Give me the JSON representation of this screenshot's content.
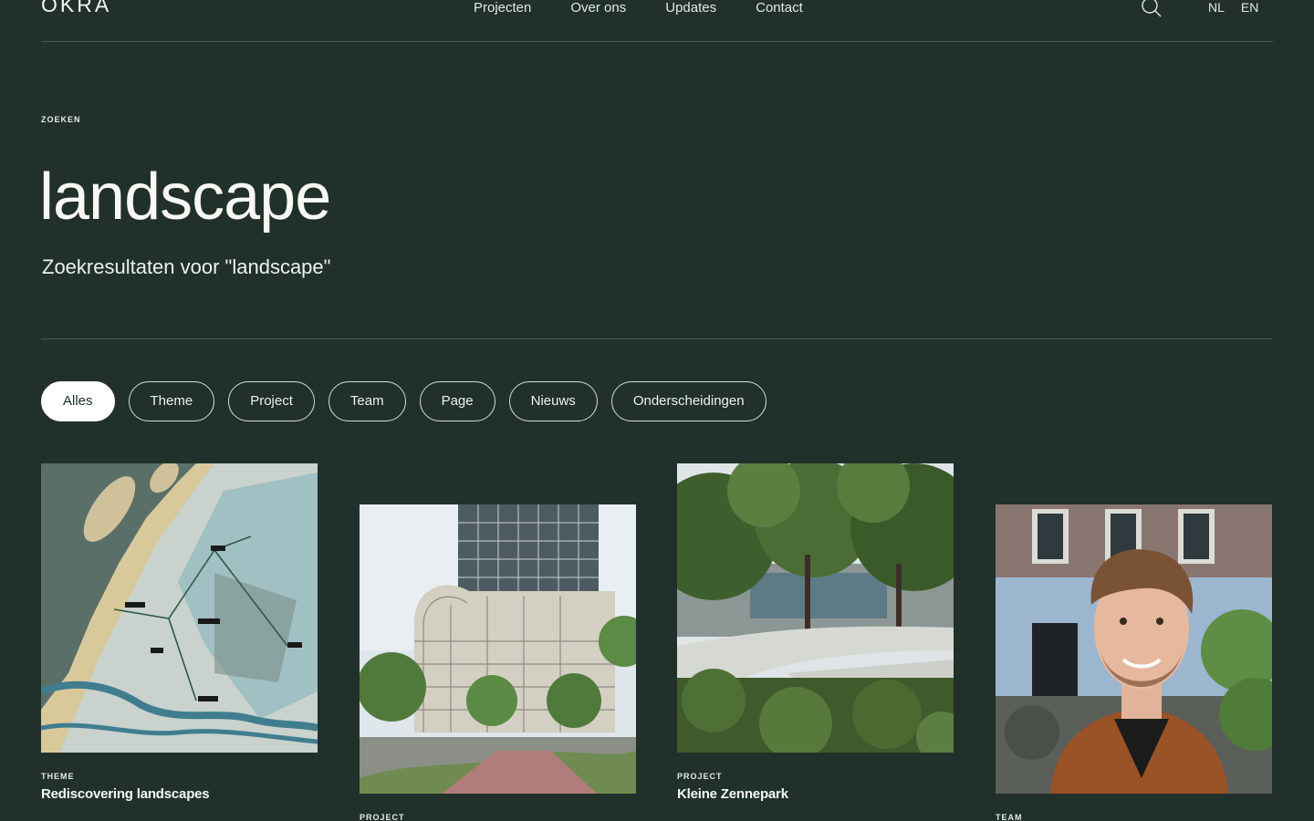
{
  "header": {
    "logo": "OKRA",
    "nav": [
      "Projecten",
      "Over ons",
      "Updates",
      "Contact"
    ],
    "search_icon": "search-icon",
    "languages": [
      "NL",
      "EN"
    ]
  },
  "search": {
    "eyebrow": "ZOEKEN",
    "query": "landscape",
    "subtitle": "Zoekresultaten voor \"landscape\""
  },
  "filters": {
    "active": "Alles",
    "items": [
      "Alles",
      "Theme",
      "Project",
      "Team",
      "Page",
      "Nieuws",
      "Onderscheidingen"
    ]
  },
  "results": [
    {
      "type": "THEME",
      "title": "Rediscovering landscapes",
      "image": "landscape-map"
    },
    {
      "type": "PROJECT",
      "title": "",
      "image": "tower-building"
    },
    {
      "type": "PROJECT",
      "title": "Kleine Zennepark",
      "image": "park-render"
    },
    {
      "type": "TEAM",
      "title": "",
      "image": "team-portrait"
    }
  ],
  "colors": {
    "background": "#21302b",
    "text": "#eef0ec",
    "divider": "#4b5853",
    "chip_active_bg": "#ffffff"
  }
}
